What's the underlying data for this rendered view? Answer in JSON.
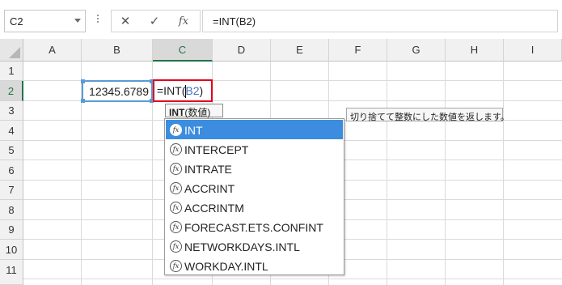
{
  "formula_bar": {
    "name_box": "C2",
    "cancel_glyph": "✕",
    "enter_glyph": "✓",
    "insert_function_glyph": "fx",
    "formula_text": "=INT(B2)"
  },
  "columns": [
    "A",
    "B",
    "C",
    "D",
    "E",
    "F",
    "G",
    "H",
    "I"
  ],
  "rows": [
    "1",
    "2",
    "3",
    "4",
    "5",
    "6",
    "7",
    "8",
    "9",
    "10",
    "11"
  ],
  "cells": {
    "B2": "12345.6789",
    "C2_prefix": "=INT(",
    "C2_ref": "B2",
    "C2_suffix": ")"
  },
  "arg_tooltip": {
    "function": "INT",
    "args": "(数値)"
  },
  "description_tooltip": "切り捨てて整数にした数値を返します。",
  "autocomplete": {
    "icon": "function-icon",
    "items": [
      "INT",
      "INTERCEPT",
      "INTRATE",
      "ACCRINT",
      "ACCRINTM",
      "FORECAST.ETS.CONFINT",
      "NETWORKDAYS.INTL",
      "WORKDAY.INTL"
    ],
    "selected_index": 0
  },
  "colors": {
    "selected_header": "#217346",
    "active_cell_border": "#e0001b",
    "reference_border": "#5b9bd5",
    "reference_text": "#4472c4",
    "autocomplete_highlight": "#3c8ddf"
  }
}
